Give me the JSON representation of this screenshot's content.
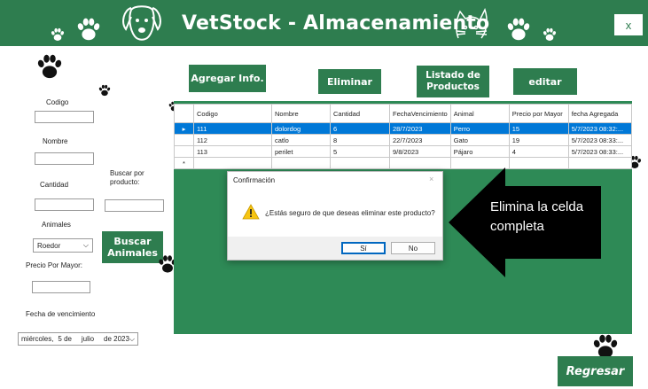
{
  "app": {
    "title": "VetStock - Almacenamiento",
    "close_label": "x"
  },
  "form": {
    "codigo_label": "Codigo",
    "nombre_label": "Nombre",
    "cantidad_label": "Cantidad",
    "animales_label": "Animales",
    "animal_selected": "Roedor",
    "precio_label": "Precio Por Mayor:",
    "fecha_label": "Fecha de vencimiento",
    "date_day": "miércoles,",
    "date_num": "5 de",
    "date_month": "julio",
    "date_year": "de 2023",
    "buscar_label": "Buscar por producto:",
    "buscar_animales_label": "Buscar Animales"
  },
  "toolbar": {
    "agregar": "Agregar Info.",
    "eliminar": "Eliminar",
    "listado": "Listado de Productos",
    "editar": "editar",
    "regresar": "Regresar"
  },
  "grid": {
    "columns": [
      "Codigo",
      "Nombre",
      "Cantidad",
      "FechaVencimiento",
      "Animal",
      "Precio por Mayor",
      "fecha Agregada"
    ],
    "rows": [
      [
        "111",
        "dolordog",
        "6",
        "28/7/2023",
        "Perro",
        "15",
        "5/7/2023 08:32:..."
      ],
      [
        "112",
        "catlo",
        "8",
        "22/7/2023",
        "Gato",
        "19",
        "5/7/2023 08:33:..."
      ],
      [
        "113",
        "perilet",
        "5",
        "9/8/2023",
        "Pájaro",
        "4",
        "5/7/2023 08:33:..."
      ]
    ],
    "current_row_marker": "▸",
    "new_row_marker": "*"
  },
  "dialog": {
    "title": "Confirmación",
    "close": "×",
    "message": "¿Estás seguro de que deseas eliminar este producto?",
    "yes": "Sí",
    "no": "No"
  },
  "callout": {
    "line1": "Elimina la celda",
    "line2": "completa"
  },
  "colors": {
    "brand_green": "#2e7d4f",
    "grid_green": "#2e8a56",
    "selection": "#0078d7"
  },
  "icons": [
    "paw-icon",
    "dog-face-icon",
    "cat-face-icon",
    "warning-icon",
    "chevron-down-icon",
    "arrow-left-icon"
  ]
}
